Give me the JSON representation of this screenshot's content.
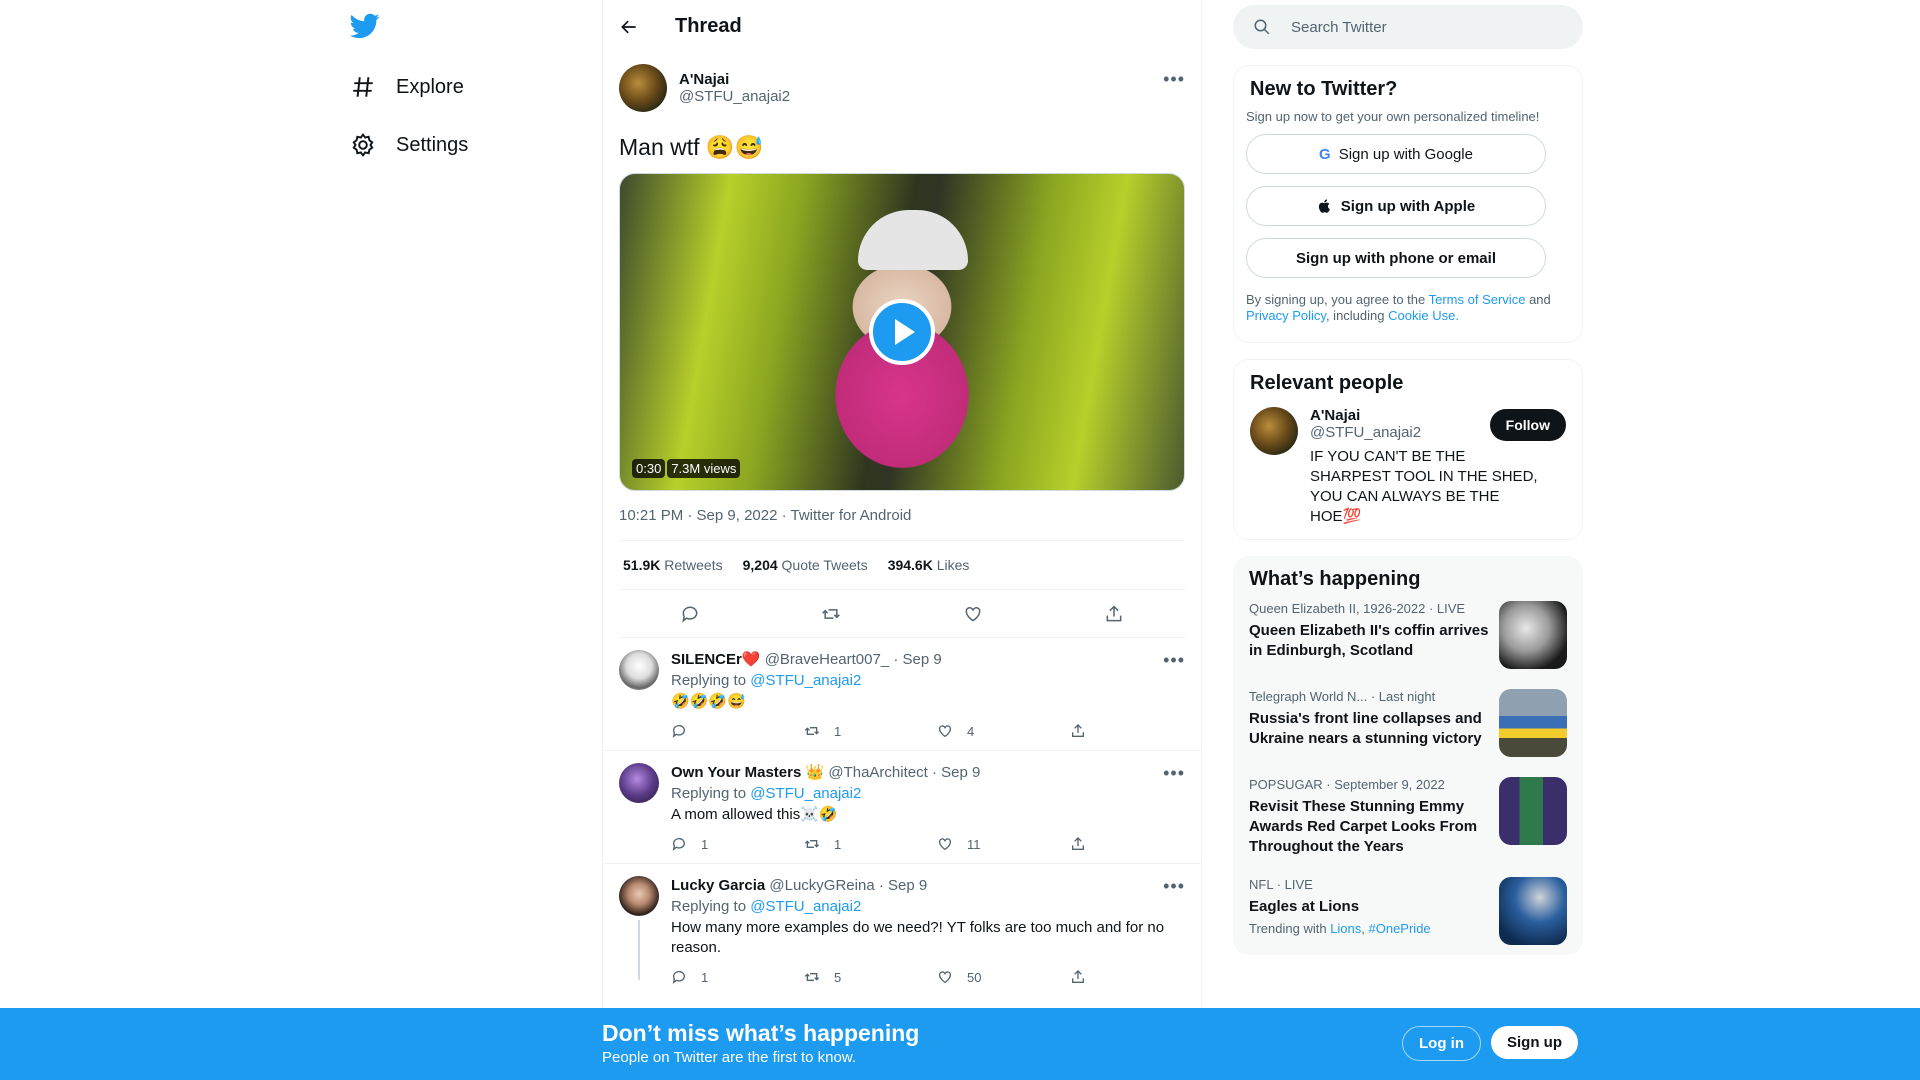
{
  "nav": {
    "logo": "twitter-bird-icon",
    "items": [
      {
        "label": "Explore",
        "icon": "hashtag-icon"
      },
      {
        "label": "Settings",
        "icon": "gear-icon"
      }
    ]
  },
  "header": {
    "title": "Thread"
  },
  "tweet": {
    "display_name": "A'Najai",
    "handle": "@STFU_anajai2",
    "text": "Man wtf 😩😅",
    "media": {
      "duration": "0:30",
      "views": "7.3M views"
    },
    "timestamp": "10:21 PM · Sep 9, 2022 · Twitter for Android",
    "stats": {
      "retweets": "51.9K",
      "retweets_label": "Retweets",
      "quotes": "9,204",
      "quotes_label": "Quote Tweets",
      "likes": "394.6K",
      "likes_label": "Likes"
    }
  },
  "replies": [
    {
      "display_name": "SILENCEr❤️",
      "handle": "@BraveHeart007_",
      "date": "· Sep 9",
      "replying_prefix": "Replying to",
      "replying_to": "@STFU_anajai2",
      "text": "🤣🤣🤣😅",
      "replies": "",
      "retweets": "1",
      "likes": "4"
    },
    {
      "display_name": "Own Your Masters 👑",
      "handle": "@ThaArchitect",
      "date": "· Sep 9",
      "replying_prefix": "Replying to",
      "replying_to": "@STFU_anajai2",
      "text": "A mom allowed this☠️🤣",
      "replies": "1",
      "retweets": "1",
      "likes": "11"
    },
    {
      "display_name": "Lucky Garcia",
      "handle": "@LuckyGReina",
      "date": "· Sep 9",
      "replying_prefix": "Replying to",
      "replying_to": "@STFU_anajai2",
      "text": "How many more examples do we need?! YT folks are too much and for no reason.",
      "replies": "1",
      "retweets": "5",
      "likes": "50"
    }
  ],
  "search": {
    "placeholder": "Search Twitter"
  },
  "new_to_twitter": {
    "title": "New to Twitter?",
    "subtitle": "Sign up now to get your own personalized timeline!",
    "google": "Sign up with Google",
    "apple": "Sign up with Apple",
    "phone": "Sign up with phone or email",
    "terms_prefix": "By signing up, you agree to the",
    "terms_link": "Terms of Service",
    "and": "and",
    "privacy_link": "Privacy Policy",
    "including": ", including",
    "cookie_link": "Cookie Use."
  },
  "relevant": {
    "title": "Relevant people",
    "display_name": "A'Najai",
    "handle": "@STFU_anajai2",
    "follow": "Follow",
    "bio": "IF YOU CAN'T BE THE SHARPEST TOOL IN THE SHED, YOU CAN ALWAYS BE THE HOE💯"
  },
  "happening": {
    "title": "What’s happening",
    "trends": [
      {
        "meta": "Queen Elizabeth II, 1926-2022 · LIVE",
        "title": "Queen Elizabeth II's coffin arrives in Edinburgh, Scotland",
        "sub": ""
      },
      {
        "meta": "Telegraph World N... · Last night",
        "title": "Russia's front line collapses and Ukraine nears a stunning victory",
        "sub": ""
      },
      {
        "meta": "POPSUGAR · September 9, 2022",
        "title": "Revisit These Stunning Emmy Awards Red Carpet Looks From Throughout the Years",
        "sub": ""
      },
      {
        "meta": "NFL · LIVE",
        "title": "Eagles at Lions",
        "sub_prefix": "Trending with",
        "sub_link1": "Lions",
        "sub_link2": "#OnePride"
      }
    ]
  },
  "bottom": {
    "title": "Don’t miss what’s happening",
    "subtitle": "People on Twitter are the first to know.",
    "login": "Log in",
    "signup": "Sign up"
  },
  "colors": {
    "accent": "#1d9bf0",
    "text": "#0f1419",
    "muted": "#536471"
  }
}
